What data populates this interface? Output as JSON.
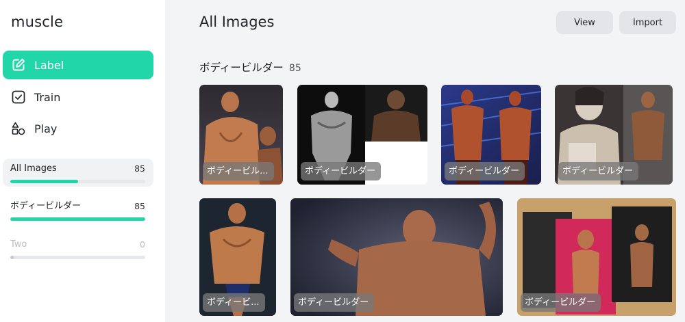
{
  "app": {
    "title": "muscle"
  },
  "sidebar": {
    "nav": [
      {
        "label": "Label",
        "icon": "edit-icon",
        "active": true
      },
      {
        "label": "Train",
        "icon": "checkbox-icon",
        "active": false
      },
      {
        "label": "Play",
        "icon": "shapes-icon",
        "active": false
      }
    ],
    "sets": [
      {
        "name": "All Images",
        "count": "85",
        "progress": 0.5,
        "selected": true
      },
      {
        "name": "ボディービルダー",
        "count": "85",
        "progress": 1.0,
        "selected": false
      },
      {
        "name": "Two",
        "count": "0",
        "progress": 0.0,
        "selected": false,
        "muted": true
      }
    ]
  },
  "header": {
    "title": "All Images",
    "view_label": "View",
    "import_label": "Import"
  },
  "section": {
    "label": "ボディービルダー",
    "count": "85"
  },
  "images": [
    {
      "tag": "ボディービル..."
    },
    {
      "tag": "ボディービルダー"
    },
    {
      "tag": "ボディービルダー"
    },
    {
      "tag": "ボディービルダー"
    },
    {
      "tag": "ボディービ..."
    },
    {
      "tag": "ボディービルダー"
    },
    {
      "tag": "ボディービルダー"
    }
  ],
  "colors": {
    "accent": "#21d6a8",
    "sidebar_bg": "#ffffff",
    "main_bg": "#f3f4f6"
  }
}
